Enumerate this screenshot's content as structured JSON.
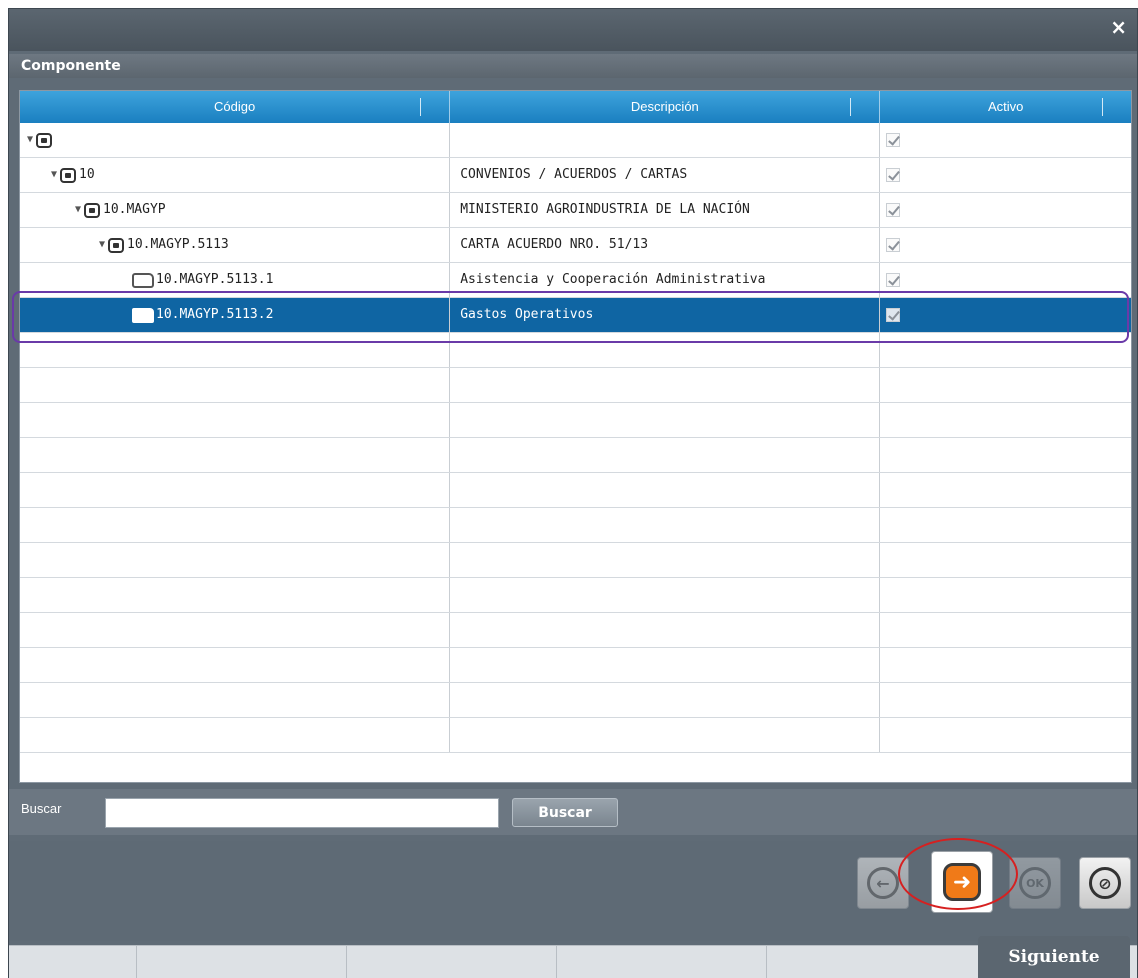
{
  "dialog": {
    "close_icon": "close-x-icon"
  },
  "section": {
    "title": "Componente"
  },
  "grid": {
    "columns": [
      "Código",
      "Descripción",
      "Activo"
    ],
    "rows": [
      {
        "level": 0,
        "icon": "node-icon",
        "expanded": true,
        "codigo": "",
        "descripcion": "",
        "activo": true
      },
      {
        "level": 1,
        "icon": "node-icon",
        "expanded": true,
        "codigo": "10",
        "descripcion": "CONVENIOS / ACUERDOS / CARTAS",
        "activo": true
      },
      {
        "level": 2,
        "icon": "node-icon",
        "expanded": true,
        "codigo": "10.MAGYP",
        "descripcion": "MINISTERIO AGROINDUSTRIA DE LA NACIÓN",
        "activo": true
      },
      {
        "level": 3,
        "icon": "node-icon",
        "expanded": true,
        "codigo": "10.MAGYP.5113",
        "descripcion": "CARTA ACUERDO NRO. 51/13",
        "activo": true
      },
      {
        "level": 4,
        "icon": "folder-outline-icon",
        "expanded": false,
        "codigo": "10.MAGYP.5113.1",
        "descripcion": "Asistencia y Cooperación Administrativa",
        "activo": true
      },
      {
        "level": 4,
        "icon": "folder-filled-icon",
        "expanded": false,
        "codigo": "10.MAGYP.5113.2",
        "descripcion": "Gastos Operativos",
        "activo": true,
        "selected": true
      }
    ],
    "empty_rows": 12
  },
  "search": {
    "label": "Buscar",
    "value": "",
    "button_label": "Buscar"
  },
  "toolbar": {
    "back_icon": "arrow-left-icon",
    "next_icon": "arrow-right-icon",
    "ok_label": "OK",
    "cancel_icon": "cancel-icon"
  },
  "tooltip": {
    "text": "Siguiente"
  },
  "colors": {
    "header": "#1a7fc0",
    "selected": "#0f65a3",
    "accent": "#f07a18"
  }
}
